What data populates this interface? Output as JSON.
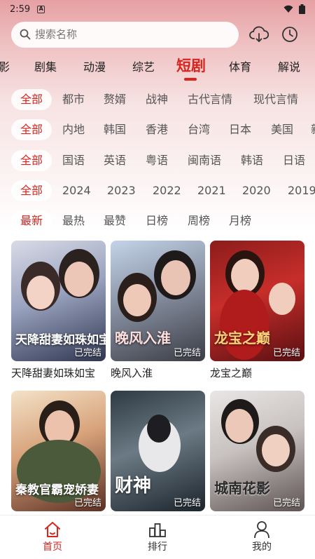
{
  "status_bar": {
    "time": "2:59"
  },
  "search": {
    "placeholder": "搜索名称"
  },
  "categories": [
    "影",
    "剧集",
    "动漫",
    "综艺",
    "短剧",
    "体育",
    "解说"
  ],
  "filters": {
    "genre": [
      "全部",
      "都市",
      "赘婿",
      "战神",
      "古代言情",
      "现代言情"
    ],
    "region": [
      "全部",
      "内地",
      "韩国",
      "香港",
      "台湾",
      "日本",
      "美国",
      "新"
    ],
    "language": [
      "全部",
      "国语",
      "英语",
      "粤语",
      "闽南语",
      "韩语",
      "日语"
    ],
    "year": [
      "全部",
      "2024",
      "2023",
      "2022",
      "2021",
      "2020",
      "2019"
    ],
    "sort": [
      "最新",
      "最热",
      "最赞",
      "日榜",
      "周榜",
      "月榜"
    ]
  },
  "videos": [
    {
      "name": "天降甜妻如珠如宝",
      "poster_title": "天降甜妻如珠如宝",
      "badge": "已完结"
    },
    {
      "name": "晚风入淮",
      "poster_title": "晚风入淮",
      "badge": "已完结"
    },
    {
      "name": "龙宝之巅",
      "poster_title": "龙宝之巅",
      "badge": "已完结"
    },
    {
      "name": "",
      "poster_title": "秦教官霸宠娇妻",
      "badge": "已完结"
    },
    {
      "name": "",
      "poster_title": "财神",
      "badge": "已完结"
    },
    {
      "name": "",
      "poster_title": "城南花影",
      "badge": "已完结"
    }
  ],
  "bottom_nav": [
    "首页",
    "排行",
    "我的"
  ],
  "colors": {
    "accent": "#d7261f",
    "top_gradient": "#e6a0a4"
  }
}
